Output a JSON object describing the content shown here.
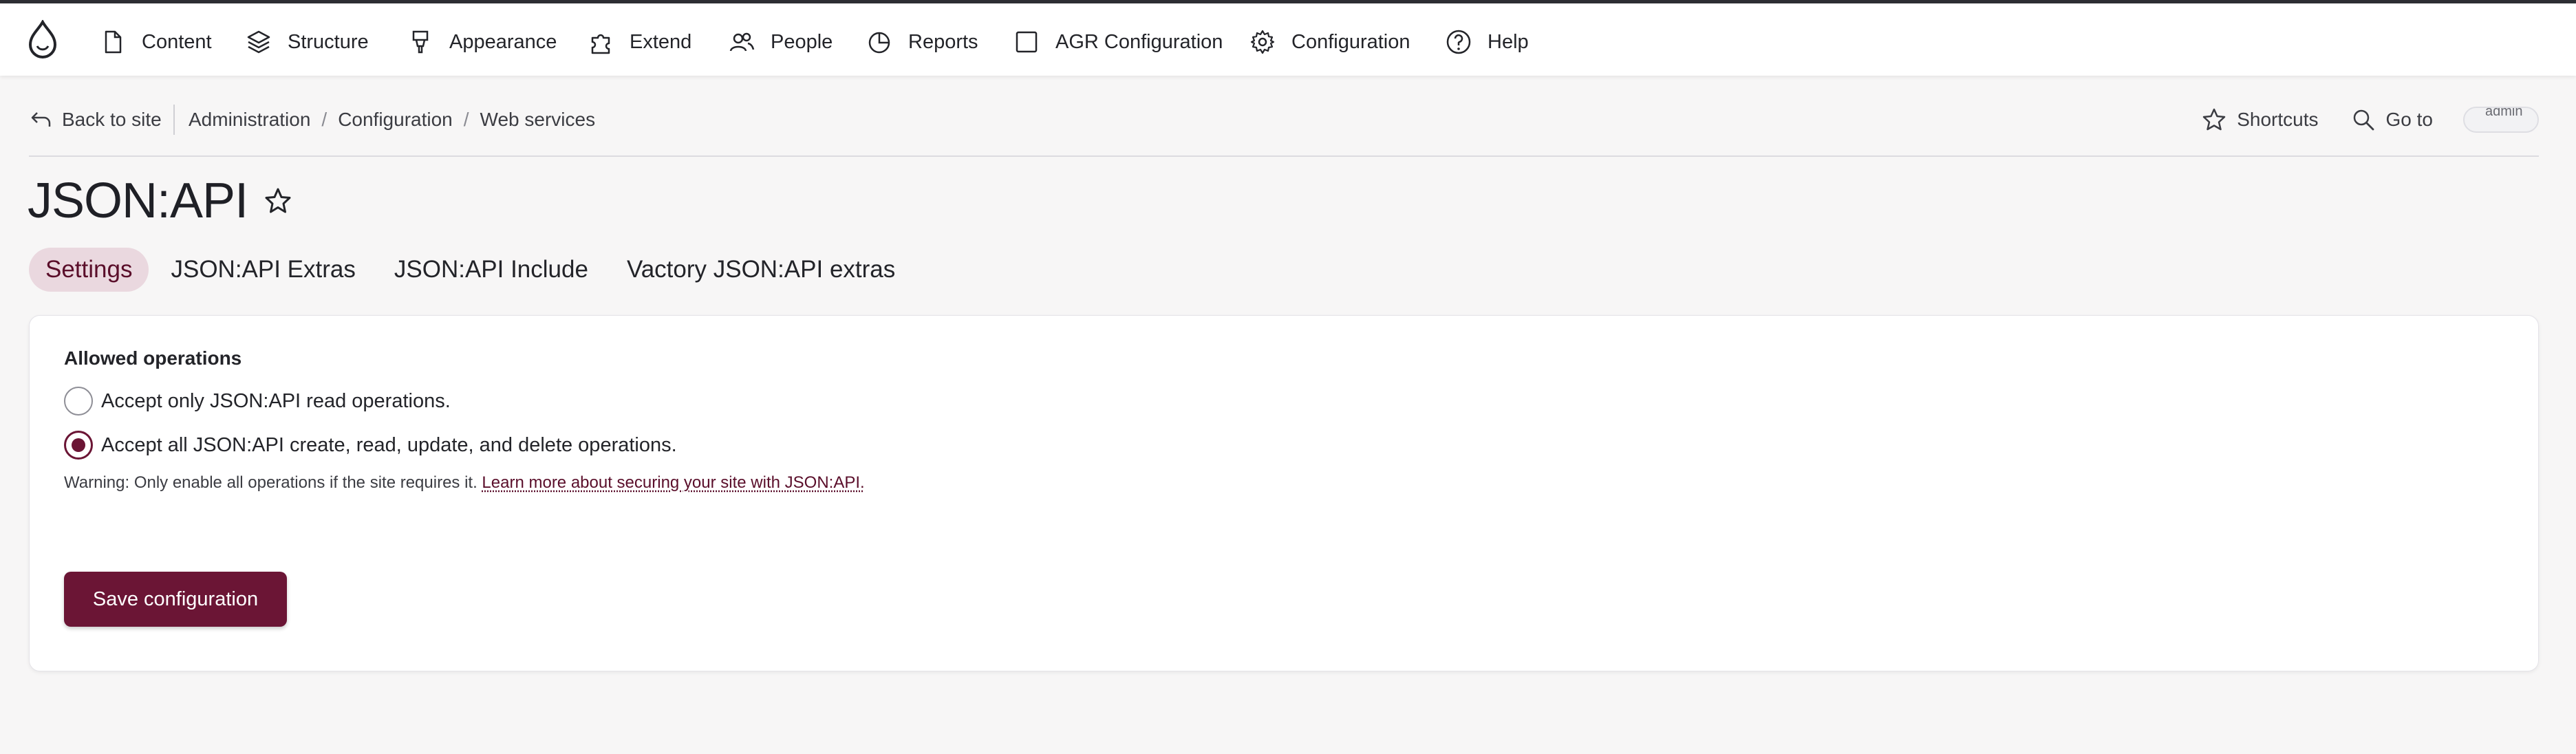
{
  "toolbar": {
    "items": [
      {
        "label": "Content",
        "icon": "document-icon"
      },
      {
        "label": "Structure",
        "icon": "layers-icon"
      },
      {
        "label": "Appearance",
        "icon": "paintbrush-icon"
      },
      {
        "label": "Extend",
        "icon": "puzzle-icon"
      },
      {
        "label": "People",
        "icon": "people-icon"
      },
      {
        "label": "Reports",
        "icon": "pie-chart-icon"
      },
      {
        "label": "AGR Configuration",
        "icon": "square-icon"
      },
      {
        "label": "Configuration",
        "icon": "gear-icon"
      },
      {
        "label": "Help",
        "icon": "help-icon"
      }
    ]
  },
  "subbar": {
    "back_label": "Back to site",
    "breadcrumb": [
      "Administration",
      "Configuration",
      "Web services"
    ],
    "breadcrumb_separator": "/",
    "shortcuts_label": "Shortcuts",
    "goto_label": "Go to",
    "avatar_alt": "admin"
  },
  "page": {
    "title": "JSON:API"
  },
  "tabs": [
    {
      "label": "Settings",
      "active": true
    },
    {
      "label": "JSON:API Extras",
      "active": false
    },
    {
      "label": "JSON:API Include",
      "active": false
    },
    {
      "label": "Vactory JSON:API extras",
      "active": false
    }
  ],
  "form": {
    "legend": "Allowed operations",
    "options": [
      {
        "label": "Accept only JSON:API read operations.",
        "checked": false
      },
      {
        "label": "Accept all JSON:API create, read, update, and delete operations.",
        "checked": true
      }
    ],
    "warning_text": "Warning: Only enable all operations if the site requires it. ",
    "warning_link": "Learn more about securing your site with JSON:API.",
    "save_label": "Save configuration"
  },
  "colors": {
    "accent": "#6b1535",
    "active_tab_bg": "#ead8df",
    "page_bg": "#f7f6f6"
  }
}
